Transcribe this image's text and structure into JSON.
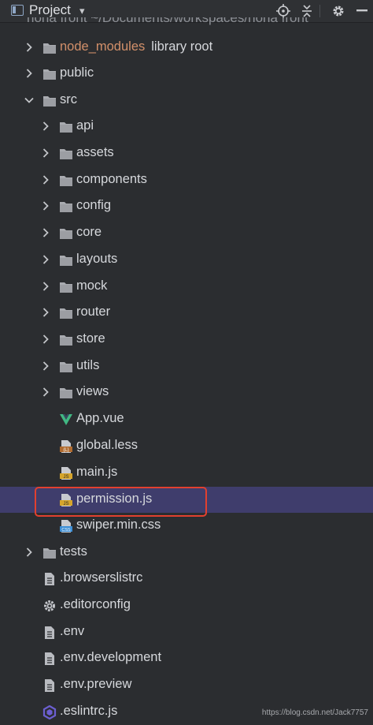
{
  "toolbar": {
    "title": "Project",
    "dropdown_glyph": "▾",
    "buttons": [
      "locate-icon",
      "collapse-all-icon",
      "settings-icon"
    ]
  },
  "partial_row": "nona front ~/Documents/workspaces/nona front",
  "tree": [
    {
      "label": "node_modules",
      "hint": "library root",
      "type": "folder",
      "expanded": false,
      "excluded": true
    },
    {
      "label": "public",
      "type": "folder",
      "expanded": false
    },
    {
      "label": "src",
      "type": "folder",
      "expanded": true
    },
    {
      "label": "api",
      "type": "folder",
      "expanded": false
    },
    {
      "label": "assets",
      "type": "folder",
      "expanded": false
    },
    {
      "label": "components",
      "type": "folder",
      "expanded": false
    },
    {
      "label": "config",
      "type": "folder",
      "expanded": false
    },
    {
      "label": "core",
      "type": "folder",
      "expanded": false
    },
    {
      "label": "layouts",
      "type": "folder",
      "expanded": false
    },
    {
      "label": "mock",
      "type": "folder",
      "expanded": false
    },
    {
      "label": "router",
      "type": "folder",
      "expanded": false
    },
    {
      "label": "store",
      "type": "folder",
      "expanded": false
    },
    {
      "label": "utils",
      "type": "folder",
      "expanded": false
    },
    {
      "label": "views",
      "type": "folder",
      "expanded": false
    },
    {
      "label": "App.vue",
      "type": "vue-file"
    },
    {
      "label": "global.less",
      "type": "less-file"
    },
    {
      "label": "main.js",
      "type": "js-file"
    },
    {
      "label": "permission.js",
      "type": "js-file",
      "selected": true
    },
    {
      "label": "swiper.min.css",
      "type": "css-file"
    },
    {
      "label": "tests",
      "type": "folder",
      "expanded": false
    },
    {
      "label": ".browserslistrc",
      "type": "text-file"
    },
    {
      "label": ".editorconfig",
      "type": "config-file"
    },
    {
      "label": ".env",
      "type": "text-file"
    },
    {
      "label": ".env.development",
      "type": "text-file"
    },
    {
      "label": ".env.preview",
      "type": "text-file"
    },
    {
      "label": ".eslintrc.js",
      "type": "eslint-file"
    }
  ],
  "watermark": "https://blog.csdn.net/Jack7757",
  "colors": {
    "background": "#2b2d30",
    "selection": "#3f3d6c",
    "highlight_border": "#e2402f",
    "excluded_text": "#d3906a"
  }
}
